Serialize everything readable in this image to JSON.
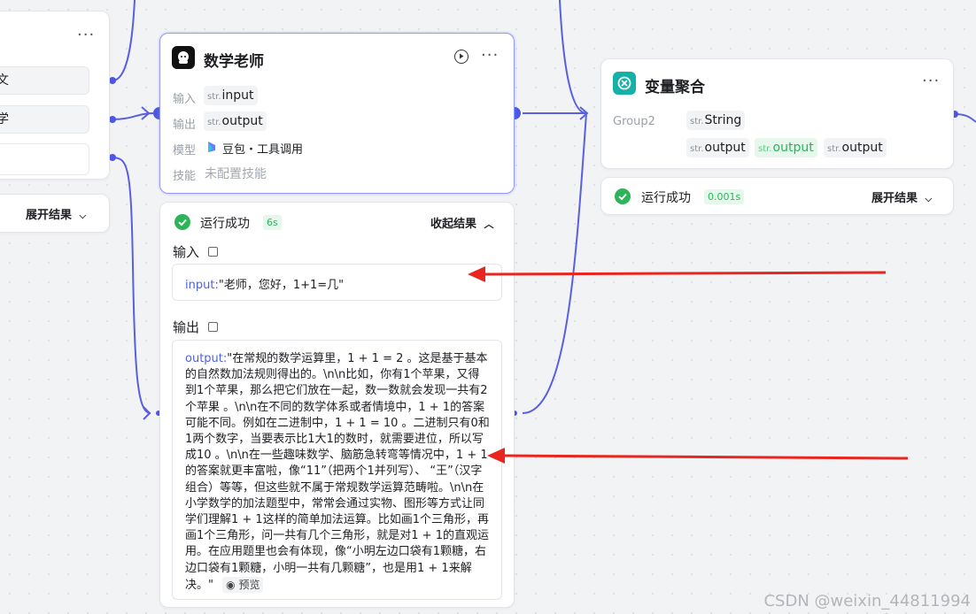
{
  "left_node": {
    "pill1": "文",
    "pill2": "学",
    "pill3": "",
    "expand_label": "展开结果"
  },
  "math_node": {
    "title": "数学老师",
    "rows": {
      "input_label": "输入",
      "input_type": "str.",
      "input_name": "input",
      "output_label": "输出",
      "output_type": "str.",
      "output_name": "output",
      "model_label": "模型",
      "model_value": "豆包・工具调用",
      "skill_label": "技能",
      "skill_value": "未配置技能"
    }
  },
  "math_result": {
    "status": "运行成功",
    "time": "6s",
    "collapse_label": "收起结果",
    "input_title": "输入",
    "input_key": "input",
    "input_value": "\"老师，您好，1+1=几\"",
    "output_title": "输出",
    "output_key": "output",
    "output_value": "\"在常规的数学运算里，1 + 1 = 2 。这是基于基本的自然数加法规则得出的。\\n\\n比如，你有1个苹果，又得到1个苹果，那么把它们放在一起，数一数就会发现一共有2个苹果 。\\n\\n在不同的数学体系或者情境中，1 + 1的答案可能不同。例如在二进制中，1 + 1 = 10 。二进制只有0和1两个数字，当要表示比1大1的数时，就需要进位，所以写成10 。\\n\\n在一些趣味数学、脑筋急转弯等情况中，1 + 1的答案就更丰富啦，像“11”（把两个1并列写）、 “王”（汉字组合）等等，但这些就不属于常规数学运算范畴啦。\\n\\n在小学数学的加法题型中，常常会通过实物、图形等方式让同学们理解1 + 1这样的简单加法运算。比如画1个三角形，再画1个三角形，问一共有几个三角形，就是对1 + 1的直观运用。在应用题里也会有体现，像“小明左边口袋有1颗糖，右边口袋有1颗糖，小明一共有几颗糖”，也是用1 + 1来解决。\"",
    "preview_label": "预览"
  },
  "agg_node": {
    "title": "变量聚合",
    "group_label": "Group2",
    "str_prefix": "str.",
    "group_type": "String",
    "var1": "output",
    "var2": "output",
    "var3": "output"
  },
  "agg_result": {
    "status": "运行成功",
    "time": "0.001s",
    "expand_label": "展开结果"
  },
  "watermark": "CSDN @weixin_44811994",
  "colors": {
    "accent": "#4c57e6",
    "success": "#2db35a",
    "arrow": "#e8261f",
    "teal": "#15b0a6"
  }
}
